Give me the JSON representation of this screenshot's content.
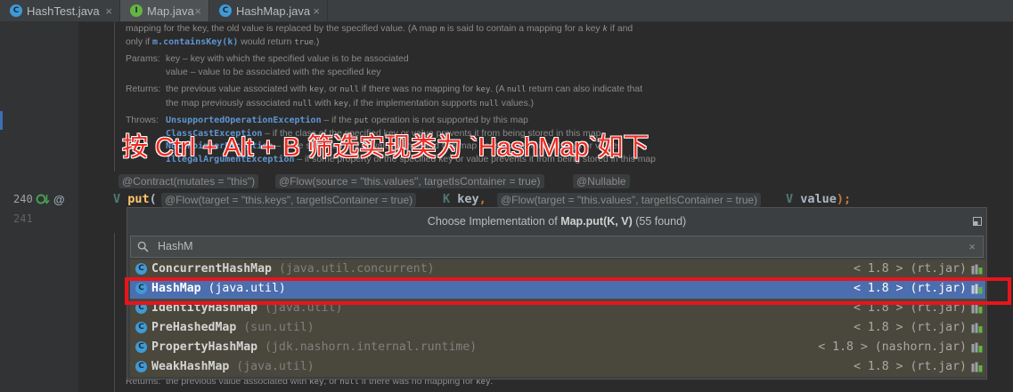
{
  "tabs": [
    {
      "label": "HashTest.java",
      "letter": "C",
      "icon": "class-icon"
    },
    {
      "label": "Map.java",
      "letter": "I",
      "icon": "interface-icon"
    },
    {
      "label": "HashMap.java",
      "letter": "C",
      "icon": "class-icon"
    }
  ],
  "active_tab": 1,
  "tab_close": "×",
  "gutter": {
    "line_numbers": [
      "240",
      "241"
    ],
    "annotation_marker": "@"
  },
  "doc": {
    "intro1": [
      "mapping for the key, the old value is replaced by the specified value. (A map ",
      "m",
      " is said to contain a mapping for a key ",
      "k",
      " if and"
    ],
    "intro2": [
      "only if ",
      "m.containsKey(k)",
      " would return ",
      "true",
      ".)"
    ],
    "params_label": "Params:",
    "params": [
      "key – key with which the specified value is to be associated",
      "value – value to be associated with the specified key"
    ],
    "returns_label": "Returns:",
    "returns1": [
      "the previous value associated with ",
      "key",
      ", or ",
      "null",
      " if there was no mapping for ",
      "key",
      ". (A ",
      "null",
      " return can also indicate that"
    ],
    "returns2": [
      "the map previously associated ",
      "null",
      " with ",
      "key",
      ", if the implementation supports ",
      "null",
      " values.)"
    ],
    "throws_label": "Throws:",
    "throws": [
      [
        "UnsupportedOperationException",
        " – if the ",
        "put",
        " operation is not supported by this map"
      ],
      [
        "ClassCastException",
        " – if the class of the specified key or value prevents it from being stored in this map"
      ],
      [
        "NullPointerException",
        " – if the specified key or value is null and this map does not permit null keys or values"
      ],
      [
        "IllegalArgumentException",
        " – if some property of the specified key or value prevents it from being stored in this map"
      ]
    ],
    "bottom_returns": [
      "the previous value associated with ",
      "key",
      ", or ",
      "null",
      " if there was no mapping for ",
      "key",
      "."
    ]
  },
  "inlay_hints": [
    "@Contract(mutates = \"this\")",
    "@Flow(source = \"this.values\", targetIsContainer = true)",
    "@Nullable"
  ],
  "code_line": {
    "ret_type": "V",
    "method": "put",
    "open": "(",
    "hint1": "@Flow(target = \"this.keys\", targetIsContainer = true)",
    "type1": "K",
    "param1": "key",
    "comma": ",",
    "hint2": "@Flow(target = \"this.values\", targetIsContainer = true)",
    "type2": "V",
    "param2": "value",
    "close": ");"
  },
  "overlay_annotation": "按 Ctrl + Alt + B 筛选实现类为 `HashMap`如下",
  "popup": {
    "title_prefix": "Choose Implementation of ",
    "title_bold": "Map.put(K, V)",
    "title_suffix": " (55 found)",
    "search_value": "HashM",
    "clear": "×",
    "row_icon_letter": "C",
    "selected_index": 1,
    "rows": [
      {
        "name": "ConcurrentHashMap",
        "pkg": "(java.util.concurrent)",
        "location": "< 1.8 > (rt.jar)"
      },
      {
        "name": "HashMap",
        "pkg": "(java.util)",
        "location": "< 1.8 > (rt.jar)"
      },
      {
        "name": "IdentityHashMap",
        "pkg": "(java.util)",
        "location": "< 1.8 > (rt.jar)"
      },
      {
        "name": "PreHashedMap",
        "pkg": "(sun.util)",
        "location": "< 1.8 > (rt.jar)"
      },
      {
        "name": "PropertyHashMap",
        "pkg": "(jdk.nashorn.internal.runtime)",
        "location": "< 1.8 > (nashorn.jar)"
      },
      {
        "name": "WeakHashMap",
        "pkg": "(java.util)",
        "location": "< 1.8 > (rt.jar)"
      }
    ]
  },
  "icons": [
    "class-icon",
    "interface-icon",
    "close-icon",
    "implemented-icon",
    "search-icon",
    "pin-icon",
    "library-jar-icon"
  ],
  "colors": {
    "selection": "#4b6eaf",
    "highlight_box": "#e8141c",
    "annotation_text": "#ef2a21",
    "library_row": "#4a483c"
  }
}
